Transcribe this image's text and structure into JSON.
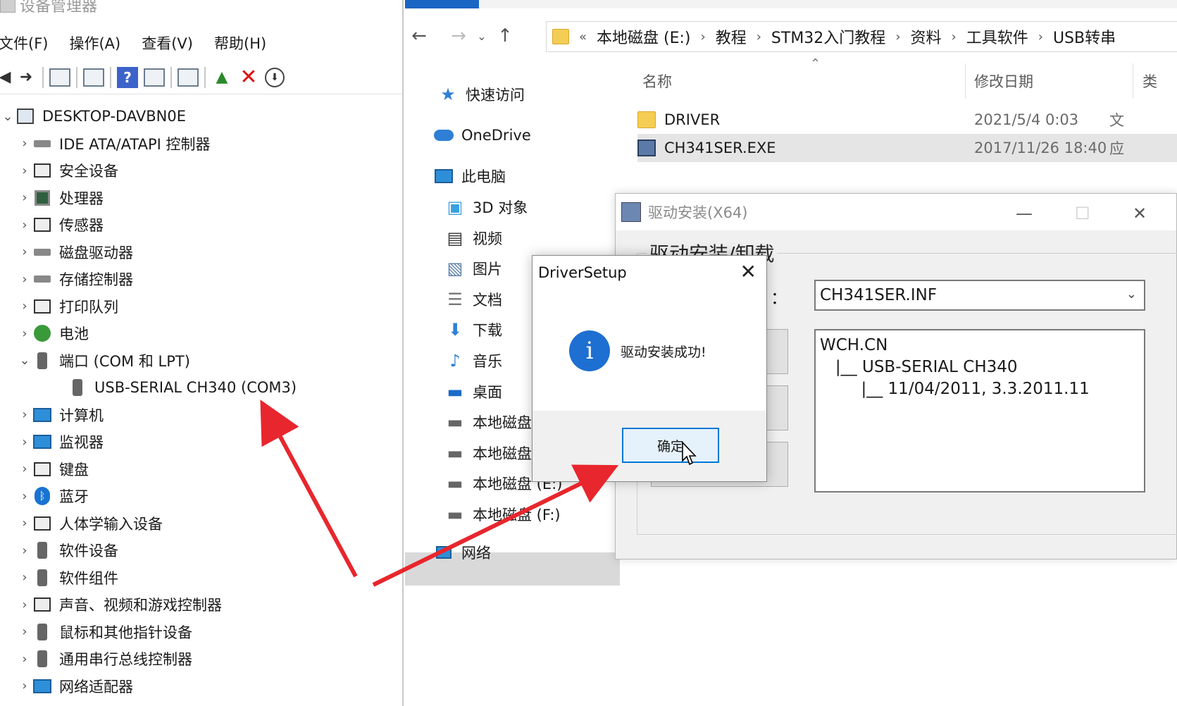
{
  "device_manager": {
    "title": "设备管理器",
    "menu": [
      "文件(F)",
      "操作(A)",
      "查看(V)",
      "帮助(H)"
    ],
    "root": "DESKTOP-DAVBN0E",
    "categories": [
      {
        "label": "IDE ATA/ATAPI 控制器",
        "icon": "ide-controller-icon"
      },
      {
        "label": "安全设备",
        "icon": "security-device-icon"
      },
      {
        "label": "处理器",
        "icon": "processor-icon"
      },
      {
        "label": "传感器",
        "icon": "sensor-icon"
      },
      {
        "label": "磁盘驱动器",
        "icon": "disk-drive-icon"
      },
      {
        "label": "存储控制器",
        "icon": "storage-controller-icon"
      },
      {
        "label": "打印队列",
        "icon": "printer-icon"
      },
      {
        "label": "电池",
        "icon": "battery-icon"
      },
      {
        "label": "端口 (COM 和 LPT)",
        "icon": "port-icon",
        "expanded": true,
        "children": [
          "USB-SERIAL CH340 (COM3)"
        ]
      },
      {
        "label": "计算机",
        "icon": "computer-icon"
      },
      {
        "label": "监视器",
        "icon": "monitor-icon"
      },
      {
        "label": "键盘",
        "icon": "keyboard-icon"
      },
      {
        "label": "蓝牙",
        "icon": "bluetooth-icon"
      },
      {
        "label": "人体学输入设备",
        "icon": "hid-icon"
      },
      {
        "label": "软件设备",
        "icon": "software-device-icon"
      },
      {
        "label": "软件组件",
        "icon": "software-component-icon"
      },
      {
        "label": "声音、视频和游戏控制器",
        "icon": "sound-icon"
      },
      {
        "label": "鼠标和其他指针设备",
        "icon": "mouse-icon"
      },
      {
        "label": "通用串行总线控制器",
        "icon": "usb-icon"
      },
      {
        "label": "网络适配器",
        "icon": "network-adapter-icon"
      }
    ]
  },
  "explorer": {
    "breadcrumb": [
      "本地磁盘 (E:)",
      "教程",
      "STM32入门教程",
      "资料",
      "工具软件",
      "USB转串"
    ],
    "nav": {
      "quick_access": "快速访问",
      "onedrive": "OneDrive",
      "this_pc": "此电脑",
      "items": [
        "3D 对象",
        "视频",
        "图片",
        "文档",
        "下载",
        "音乐",
        "桌面",
        "本地磁盘",
        "本地磁盘 (D:)",
        "本地磁盘 (E:)",
        "本地磁盘 (F:)"
      ],
      "network": "网络"
    },
    "columns": {
      "name": "名称",
      "modified": "修改日期",
      "type": "类"
    },
    "files": [
      {
        "name": "DRIVER",
        "date": "2021/5/4 0:03",
        "type": "文",
        "icon": "folder-icon"
      },
      {
        "name": "CH341SER.EXE",
        "date": "2017/11/26 18:40",
        "type": "应",
        "icon": "exe-icon",
        "selected": true
      }
    ]
  },
  "driver_window": {
    "title": "驱动安装(X64)",
    "group_title": "驱动安装/卸载",
    "select_label": "：",
    "inf_value": "CH341SER.INF",
    "info_text": "WCH.CN\n   |__ USB-SERIAL CH340\n        |__ 11/04/2011, 3.3.2011.11"
  },
  "message_box": {
    "title": "DriverSetup",
    "message": "驱动安装成功!",
    "ok_label": "确定"
  },
  "colors": {
    "accent": "#1a66c4",
    "annotation_arrow": "#e8262d",
    "info_icon": "#1d6fd1"
  }
}
